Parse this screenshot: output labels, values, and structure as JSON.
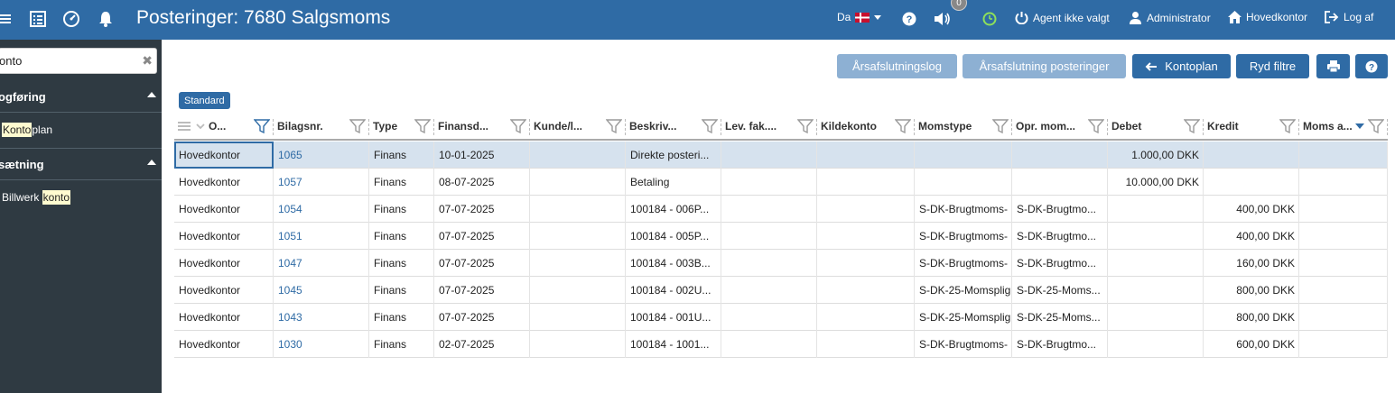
{
  "topbar": {
    "title": "Posteringer: 7680 Salgsmoms",
    "language": "Da",
    "notification_count": "0",
    "agent": "Agent ikke valgt",
    "user": "Administrator",
    "office": "Hovedkontor",
    "logout": "Log af",
    "accent_color": "#2f6ba5"
  },
  "sidebar": {
    "search_value": "onto",
    "group1": "ogføring",
    "item1_hl": "Konto",
    "item1_rest": "plan",
    "group2": "sætning",
    "item2_pre": "Billwerk ",
    "item2_hl": "konto"
  },
  "toolbar": {
    "log": "Årsafslutningslog",
    "postings": "Årsafslutning posteringer",
    "kontoplan": "Kontoplan",
    "clear": "Ryd filtre"
  },
  "view_tag": "Standard",
  "columns": [
    "O...",
    "Bilagsnr.",
    "Type",
    "Finansd...",
    "Kunde/l...",
    "Beskriv...",
    "Lev. fak....",
    "Kildekonto",
    "Momstype",
    "Opr. mom...",
    "Debet",
    "Kredit",
    "Moms a..."
  ],
  "rows": [
    [
      "Hovedkontor",
      "1065",
      "Finans",
      "10-01-2025",
      "",
      "Direkte posteri...",
      "",
      "",
      "",
      "",
      "1.000,00 DKK",
      "",
      ""
    ],
    [
      "Hovedkontor",
      "1057",
      "Finans",
      "08-07-2025",
      "",
      "Betaling",
      "",
      "",
      "",
      "",
      "10.000,00 DKK",
      "",
      ""
    ],
    [
      "Hovedkontor",
      "1054",
      "Finans",
      "07-07-2025",
      "",
      "100184 - 006P...",
      "",
      "",
      "S-DK-Brugtmoms-",
      "S-DK-Brugtmo...",
      "",
      "400,00 DKK",
      ""
    ],
    [
      "Hovedkontor",
      "1051",
      "Finans",
      "07-07-2025",
      "",
      "100184 - 005P...",
      "",
      "",
      "S-DK-Brugtmoms-",
      "S-DK-Brugtmo...",
      "",
      "400,00 DKK",
      ""
    ],
    [
      "Hovedkontor",
      "1047",
      "Finans",
      "07-07-2025",
      "",
      "100184 - 003B...",
      "",
      "",
      "S-DK-Brugtmoms-",
      "S-DK-Brugtmo...",
      "",
      "160,00 DKK",
      ""
    ],
    [
      "Hovedkontor",
      "1045",
      "Finans",
      "07-07-2025",
      "",
      "100184 - 002U...",
      "",
      "",
      "S-DK-25-Momsplig",
      "S-DK-25-Moms...",
      "",
      "800,00 DKK",
      ""
    ],
    [
      "Hovedkontor",
      "1043",
      "Finans",
      "07-07-2025",
      "",
      "100184 - 001U...",
      "",
      "",
      "S-DK-25-Momsplig",
      "S-DK-25-Moms...",
      "",
      "800,00 DKK",
      ""
    ],
    [
      "Hovedkontor",
      "1030",
      "Finans",
      "02-07-2025",
      "",
      "100184 - 1001...",
      "",
      "",
      "S-DK-Brugtmoms-",
      "S-DK-Brugtmo...",
      "",
      "600,00 DKK",
      ""
    ]
  ]
}
